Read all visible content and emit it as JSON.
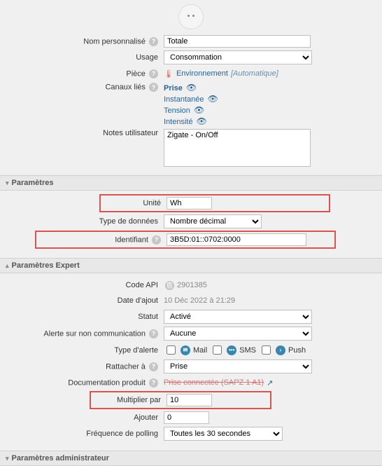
{
  "topIcon": "power-outlet",
  "general": {
    "name_lbl": "Nom personnalisé",
    "name_val": "Totale",
    "usage_lbl": "Usage",
    "usage_val": "Consommation",
    "room_lbl": "Pièce",
    "room_val": "Environnement",
    "room_suffix": "[Automatique]",
    "channels_lbl": "Canaux liés",
    "ch0": "Prise",
    "ch1": "Instantanée",
    "ch2": "Tension",
    "ch3": "Intensité",
    "notes_lbl": "Notes utilisateur",
    "notes_val": "Zigate - On/Off"
  },
  "params": {
    "header": "Paramètres",
    "unit_lbl": "Unité",
    "unit_val": "Wh",
    "dtype_lbl": "Type de données",
    "dtype_val": "Nombre décimal",
    "ident_lbl": "Identifiant",
    "ident_val": "3B5D:01::0702:0000"
  },
  "expert": {
    "header": "Paramètres Expert",
    "api_lbl": "Code API",
    "api_val": "2901385",
    "date_lbl": "Date d'ajout",
    "date_val": "10 Déc 2022 à 21:29",
    "status_lbl": "Statut",
    "status_val": "Activé",
    "alert_lbl": "Alerte sur non communication",
    "alert_val": "Aucune",
    "alerttype_lbl": "Type d'alerte",
    "mail": "Mail",
    "sms": "SMS",
    "push": "Push",
    "attach_lbl": "Rattacher à",
    "attach_val": "Prise",
    "doc_lbl": "Documentation produit",
    "doc_val": "Prise connectée (SAPZ 1 A1)",
    "mult_lbl": "Multiplier par",
    "mult_val": "10",
    "add_lbl": "Ajouter",
    "add_val": "0",
    "poll_lbl": "Fréquence de polling",
    "poll_val": "Toutes les 30 secondes"
  },
  "admin": {
    "header": "Paramètres administrateur"
  }
}
